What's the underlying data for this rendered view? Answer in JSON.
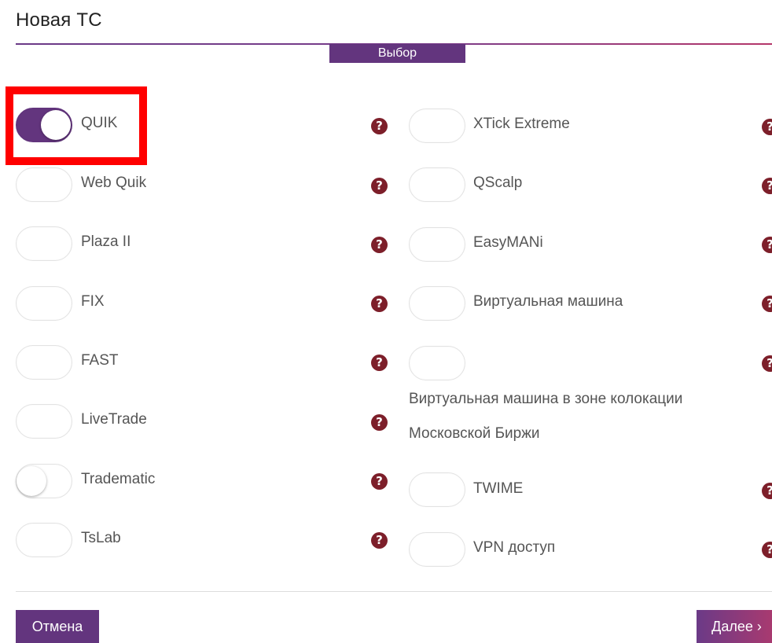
{
  "dialog": {
    "title": "Новая ТС",
    "section_tab": "Выбор"
  },
  "left_options": [
    {
      "label": "QUIK",
      "state": "on"
    },
    {
      "label": "Web Quik",
      "state": "off"
    },
    {
      "label": "Plaza II",
      "state": "off"
    },
    {
      "label": "FIX",
      "state": "off"
    },
    {
      "label": "FAST",
      "state": "off"
    },
    {
      "label": "LiveTrade",
      "state": "off"
    },
    {
      "label": "Tradematic",
      "state": "partial"
    },
    {
      "label": "TsLab",
      "state": "off"
    }
  ],
  "right_options": [
    {
      "label": "XTick Extreme",
      "state": "off"
    },
    {
      "label": "QScalp",
      "state": "off"
    },
    {
      "label": "EasyMANi",
      "state": "off"
    },
    {
      "label": "Виртуальная машина",
      "state": "off"
    },
    {
      "label": "",
      "state": "off"
    },
    {
      "label_line1": "Виртуальная машина в зоне колокации",
      "label_line2": "Московской Биржи"
    },
    {
      "label": "TWIME",
      "state": "off"
    },
    {
      "label": "VPN доступ",
      "state": "off"
    }
  ],
  "help_glyph": "?",
  "icons": {
    "help": "question-circle-icon"
  },
  "colors": {
    "accent": "#63357e",
    "help": "#7d1f2a",
    "highlight": "#ff0000"
  },
  "footer": {
    "cancel_label": "Отмена",
    "next_label": "Далее ›"
  }
}
